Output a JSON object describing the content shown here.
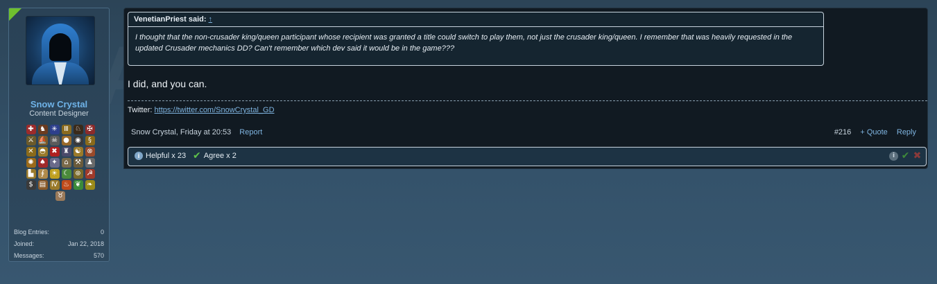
{
  "user": {
    "name": "Snow Crystal",
    "title": "Content Designer",
    "stats": [
      {
        "label": "Blog Entries:",
        "value": "0"
      },
      {
        "label": "Joined:",
        "value": "Jan 22, 2018"
      },
      {
        "label": "Messages:",
        "value": "570"
      }
    ],
    "trophies": [
      {
        "icon": "shield-cross-icon",
        "glyph": "✚",
        "color": "#9c2b2b"
      },
      {
        "icon": "horse-icon",
        "glyph": "♞",
        "color": "#6b3b1f"
      },
      {
        "icon": "union-flag-icon",
        "glyph": "✳",
        "color": "#2d3f8c"
      },
      {
        "icon": "temple-icon",
        "glyph": "Ⅲ",
        "color": "#8a6b1f"
      },
      {
        "icon": "horse-head-icon",
        "glyph": "♘",
        "color": "#3a2a1a"
      },
      {
        "icon": "banner-icon",
        "glyph": "✠",
        "color": "#8c2a2a"
      },
      {
        "icon": "crossed-swords-icon",
        "glyph": "⚔",
        "color": "#6b5a2a"
      },
      {
        "icon": "ship-icon",
        "glyph": "⛵",
        "color": "#7a5a2a"
      },
      {
        "icon": "skull-icon",
        "glyph": "☠",
        "color": "#5a5a5a"
      },
      {
        "icon": "pouch-icon",
        "glyph": "●",
        "color": "#9a6a2a"
      },
      {
        "icon": "eye-icon",
        "glyph": "◉",
        "color": "#3a3a3a"
      },
      {
        "icon": "dragon-icon",
        "glyph": "§",
        "color": "#8a6a1a"
      },
      {
        "icon": "crossed-axes-icon",
        "glyph": "✕",
        "color": "#8a6a1a"
      },
      {
        "icon": "helmet-icon",
        "glyph": "◓",
        "color": "#9a7a2a"
      },
      {
        "icon": "red-circle-icon",
        "glyph": "✖",
        "color": "#b02020"
      },
      {
        "icon": "castle-icon",
        "glyph": "♜",
        "color": "#4a4a6a"
      },
      {
        "icon": "yin-yang-icon",
        "glyph": "☯",
        "color": "#9a7a2a"
      },
      {
        "icon": "round-shield-icon",
        "glyph": "⊗",
        "color": "#9a4a2a"
      },
      {
        "icon": "sun-wheel-icon",
        "glyph": "✺",
        "color": "#9a6a1a"
      },
      {
        "icon": "spartan-helmet-icon",
        "glyph": "♠",
        "color": "#a02a2a"
      },
      {
        "icon": "star-compass-icon",
        "glyph": "✦",
        "color": "#6a6a8a"
      },
      {
        "icon": "church-icon",
        "glyph": "⌂",
        "color": "#7a6a4a"
      },
      {
        "icon": "crossed-hammers-icon",
        "glyph": "⚒",
        "color": "#6a5a3a"
      },
      {
        "icon": "elephant-icon",
        "glyph": "♟",
        "color": "#6a6a6a"
      },
      {
        "icon": "boot-icon",
        "glyph": "▙",
        "color": "#9a7a2a"
      },
      {
        "icon": "scroll-icon",
        "glyph": "∮",
        "color": "#b08a4a"
      },
      {
        "icon": "sunburst-icon",
        "glyph": "☀",
        "color": "#c0a020"
      },
      {
        "icon": "bow-icon",
        "glyph": "☾",
        "color": "#4a8a3a"
      },
      {
        "icon": "wheel-icon",
        "glyph": "⊛",
        "color": "#7a6a2a"
      },
      {
        "icon": "sickle-icon",
        "glyph": "☭",
        "color": "#a03a2a"
      },
      {
        "icon": "dollar-icon",
        "glyph": "$",
        "color": "#3a3a3a"
      },
      {
        "icon": "chest-icon",
        "glyph": "▤",
        "color": "#8a5a2a"
      },
      {
        "icon": "roman-four-icon",
        "glyph": "Ⅳ",
        "color": "#9a7a2a"
      },
      {
        "icon": "torch-icon",
        "glyph": "♨",
        "color": "#c04a1a"
      },
      {
        "icon": "leaf-sword-icon",
        "glyph": "❦",
        "color": "#3a8a3a"
      },
      {
        "icon": "laurel-icon",
        "glyph": "❧",
        "color": "#9a8a1a"
      },
      {
        "icon": "bull-skull-icon",
        "glyph": "♉",
        "color": "#9a7a5a"
      }
    ]
  },
  "quote": {
    "author": "VenetianPriest said:",
    "arrow": "↑",
    "text": "I thought that the non-crusader king/queen participant whose recipient was granted a title could switch to play them, not just the crusader king/queen. I remember that was heavily requested in the updated Crusader mechanics DD? Can't remember which dev said it would be in the game???"
  },
  "message": "I did, and you can.",
  "signature": {
    "prefix": "Twitter: ",
    "link": "https://twitter.com/SnowCrystal_GD"
  },
  "meta": {
    "author_date": "Snow Crystal, Friday at 20:53",
    "report": "Report",
    "post_number": "#216",
    "quote_label": "+ Quote",
    "reply_label": "Reply"
  },
  "reactions": {
    "helpful": "Helpful x 23",
    "agree": "Agree x 2"
  },
  "watermark": "PARADOX"
}
